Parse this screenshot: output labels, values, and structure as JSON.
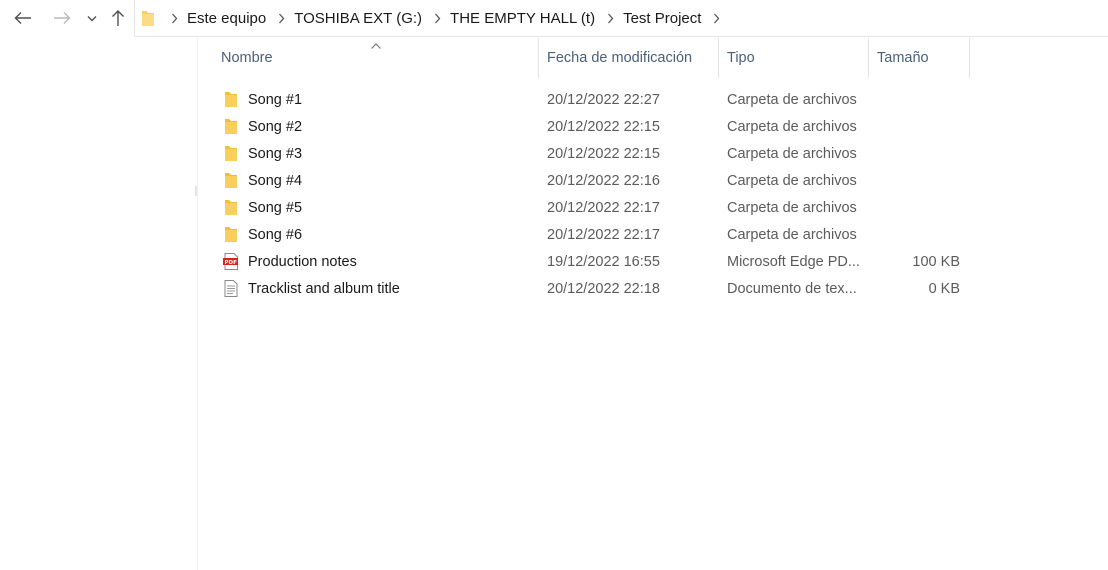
{
  "breadcrumb": [
    "Este equipo",
    "TOSHIBA EXT (G:)",
    "THE EMPTY HALL (t)",
    "Test Project"
  ],
  "columns": {
    "name": "Nombre",
    "date": "Fecha de modificación",
    "type": "Tipo",
    "size": "Tamaño"
  },
  "files": [
    {
      "icon": "folder-icon",
      "name": "Song #1",
      "date": "20/12/2022 22:27",
      "type": "Carpeta de archivos",
      "size": ""
    },
    {
      "icon": "folder-icon",
      "name": "Song #2",
      "date": "20/12/2022 22:15",
      "type": "Carpeta de archivos",
      "size": ""
    },
    {
      "icon": "folder-icon",
      "name": "Song #3",
      "date": "20/12/2022 22:15",
      "type": "Carpeta de archivos",
      "size": ""
    },
    {
      "icon": "folder-icon",
      "name": "Song #4",
      "date": "20/12/2022 22:16",
      "type": "Carpeta de archivos",
      "size": ""
    },
    {
      "icon": "folder-icon",
      "name": "Song #5",
      "date": "20/12/2022 22:17",
      "type": "Carpeta de archivos",
      "size": ""
    },
    {
      "icon": "folder-icon",
      "name": "Song #6",
      "date": "20/12/2022 22:17",
      "type": "Carpeta de archivos",
      "size": ""
    },
    {
      "icon": "pdf-icon",
      "name": "Production notes",
      "date": "19/12/2022 16:55",
      "type": "Microsoft Edge PD...",
      "size": "100 KB"
    },
    {
      "icon": "text-file-icon",
      "name": "Tracklist and album title",
      "date": "20/12/2022 22:18",
      "type": "Documento de tex...",
      "size": "0 KB"
    }
  ],
  "icons": {
    "back": "back-arrow-icon",
    "forward": "forward-arrow-icon",
    "recent": "chevron-down-icon",
    "up": "up-arrow-icon"
  },
  "colors": {
    "folder": "#f8cf5c",
    "header_text": "#4c607a",
    "pdf_red": "#d9261c"
  }
}
